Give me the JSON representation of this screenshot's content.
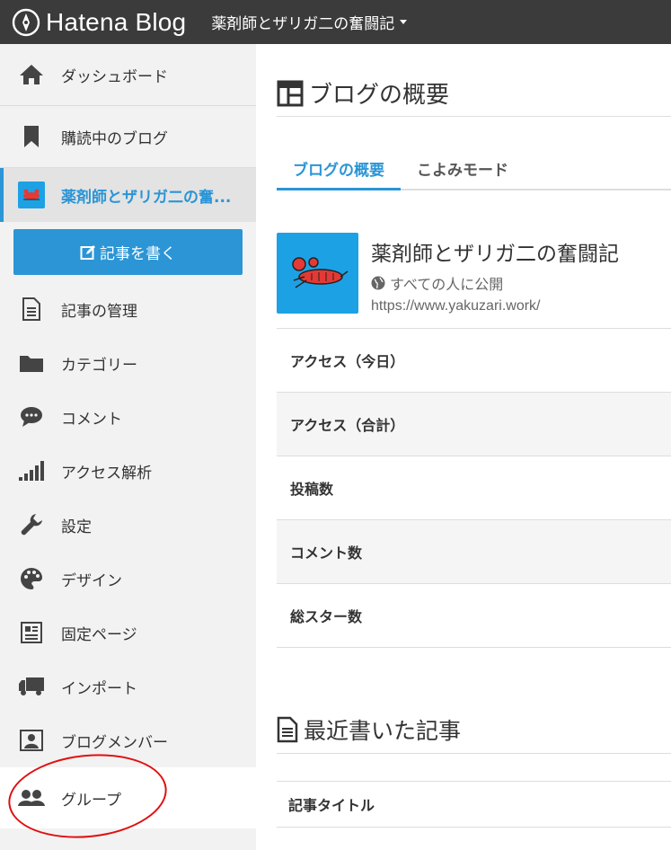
{
  "header": {
    "logo_text": "Hatena Blog",
    "blog_switcher": "薬剤師とザリガ二の奮闘記"
  },
  "sidebar": {
    "items": [
      {
        "label": "ダッシュボード",
        "icon": "home-icon"
      },
      {
        "label": "購読中のブログ",
        "icon": "bookmark-icon"
      },
      {
        "label": "薬剤師とザリガ二の奮...",
        "icon": "blog-thumbnail"
      },
      {
        "label": "記事の管理",
        "icon": "document-icon"
      },
      {
        "label": "カテゴリー",
        "icon": "folder-icon"
      },
      {
        "label": "コメント",
        "icon": "comment-icon"
      },
      {
        "label": "アクセス解析",
        "icon": "signal-icon"
      },
      {
        "label": "設定",
        "icon": "wrench-icon"
      },
      {
        "label": "デザイン",
        "icon": "palette-icon"
      },
      {
        "label": "固定ページ",
        "icon": "newspaper-icon"
      },
      {
        "label": "インポート",
        "icon": "truck-icon"
      },
      {
        "label": "ブログメンバー",
        "icon": "member-icon"
      },
      {
        "label": "グループ",
        "icon": "group-icon"
      }
    ],
    "write_button": "記事を書く",
    "accent": "#2b95d6"
  },
  "main": {
    "page_title": "ブログの概要",
    "tabs": [
      {
        "label": "ブログの概要",
        "active": true
      },
      {
        "label": "こよみモード",
        "active": false
      }
    ],
    "blog": {
      "name": "薬剤師とザリガ二の奮闘記",
      "visibility": "すべての人に公開",
      "url": "https://www.yakuzari.work/"
    },
    "stats": [
      "アクセス（今日）",
      "アクセス（合計）",
      "投稿数",
      "コメント数",
      "総スター数"
    ],
    "recent_title": "最近書いた記事",
    "recent_column": "記事タイトル"
  }
}
